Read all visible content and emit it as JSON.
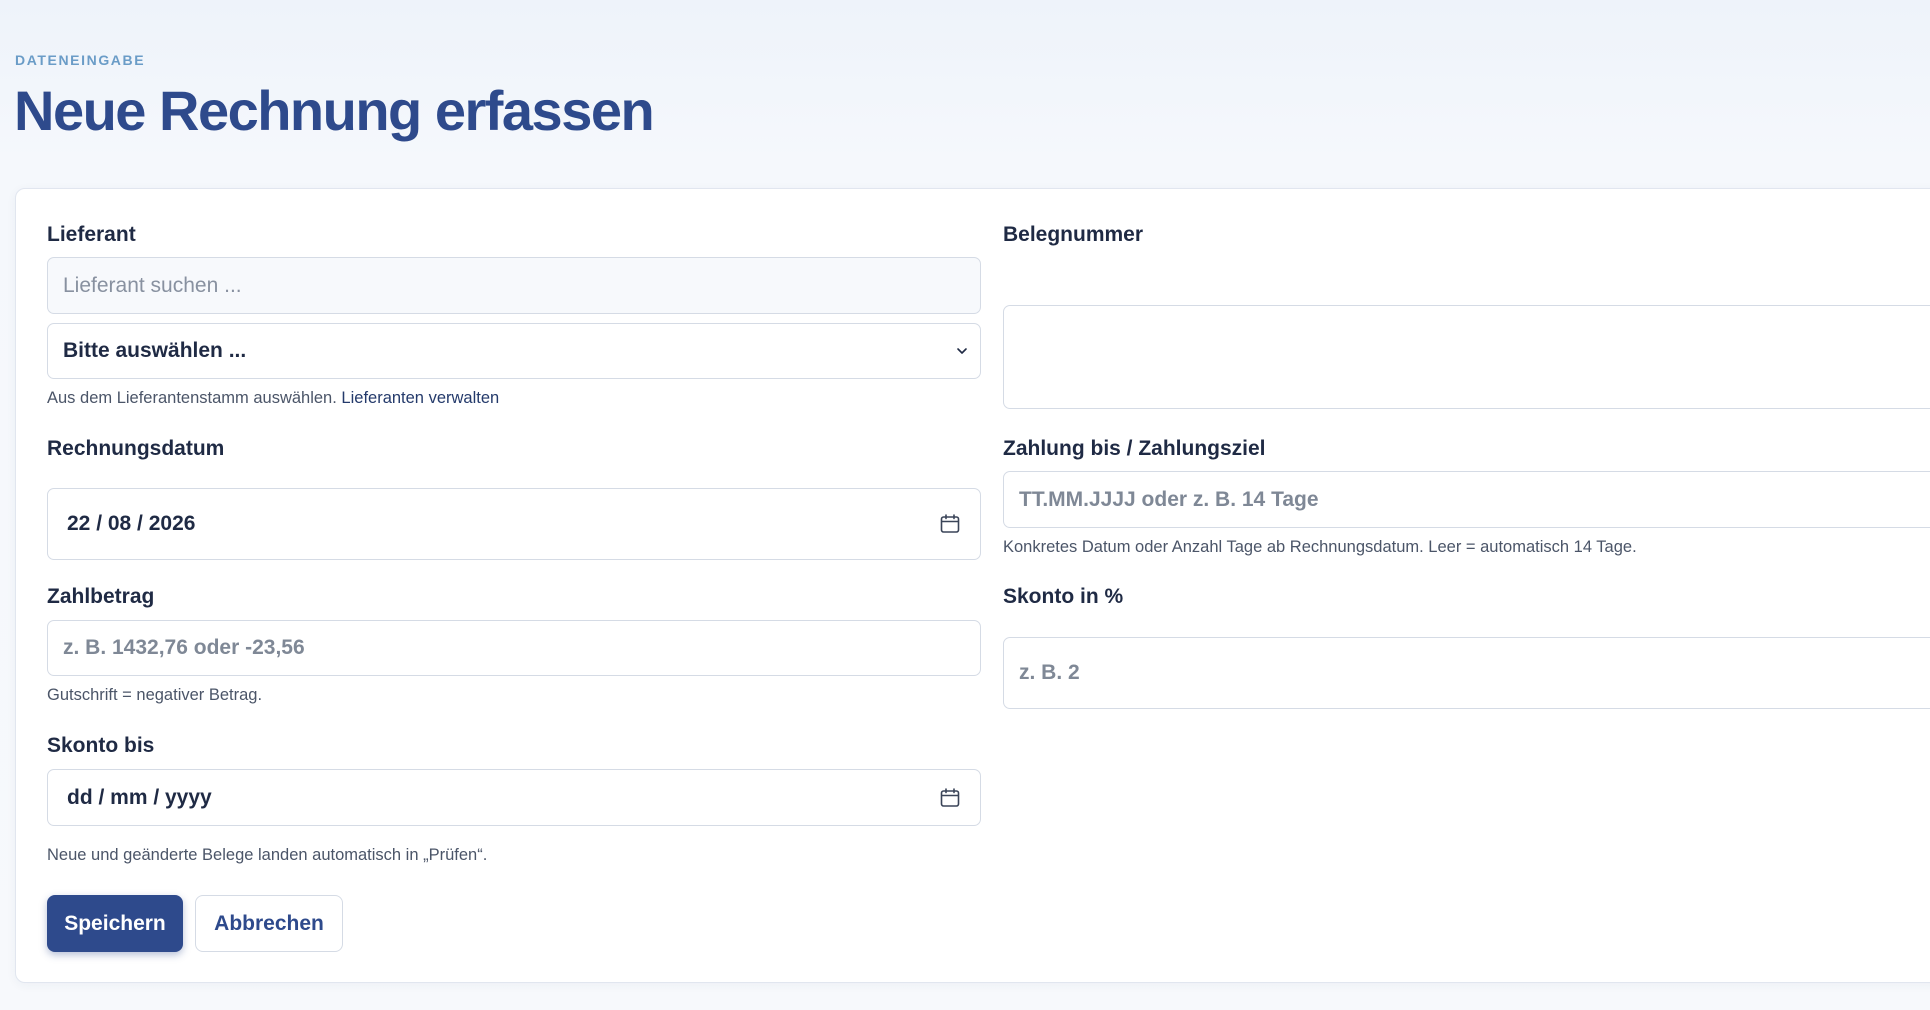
{
  "header": {
    "eyebrow": "DATENEINGABE",
    "title": "Neue Rechnung erfassen"
  },
  "form": {
    "lieferant": {
      "label": "Lieferant",
      "search_placeholder": "Lieferant suchen ...",
      "select_value": "Bitte auswählen ...",
      "help_text": "Aus dem Lieferantenstamm auswählen.",
      "help_link": "Lieferanten verwalten"
    },
    "belegnummer": {
      "label": "Belegnummer",
      "value": ""
    },
    "rechnungsdatum": {
      "label": "Rechnungsdatum",
      "value": "22 / 08 / 2026"
    },
    "zahlung_bis": {
      "label": "Zahlung bis / Zahlungsziel",
      "placeholder": "TT.MM.JJJJ oder z. B. 14 Tage",
      "help_text": "Konkretes Datum oder Anzahl Tage ab Rechnungsdatum. Leer = automatisch 14 Tage."
    },
    "zahlbetrag": {
      "label": "Zahlbetrag",
      "placeholder": "z. B. 1432,76 oder -23,56",
      "help_text": "Gutschrift = negativer Betrag."
    },
    "skonto_prozent": {
      "label": "Skonto in %",
      "placeholder": "z. B. 2"
    },
    "skonto_bis": {
      "label": "Skonto bis",
      "value": "dd / mm / yyyy"
    },
    "footer_note": "Neue und geänderte Belege landen automatisch in „Prüfen“."
  },
  "actions": {
    "save_label": "Speichern",
    "cancel_label": "Abbrechen"
  },
  "colors": {
    "primary": "#2e4a8c",
    "eyebrow": "#6a9cc7",
    "border": "#d5dbe5"
  },
  "icons": {
    "select_chevron": "chevron-down-icon",
    "date_picker": "calendar-icon"
  }
}
